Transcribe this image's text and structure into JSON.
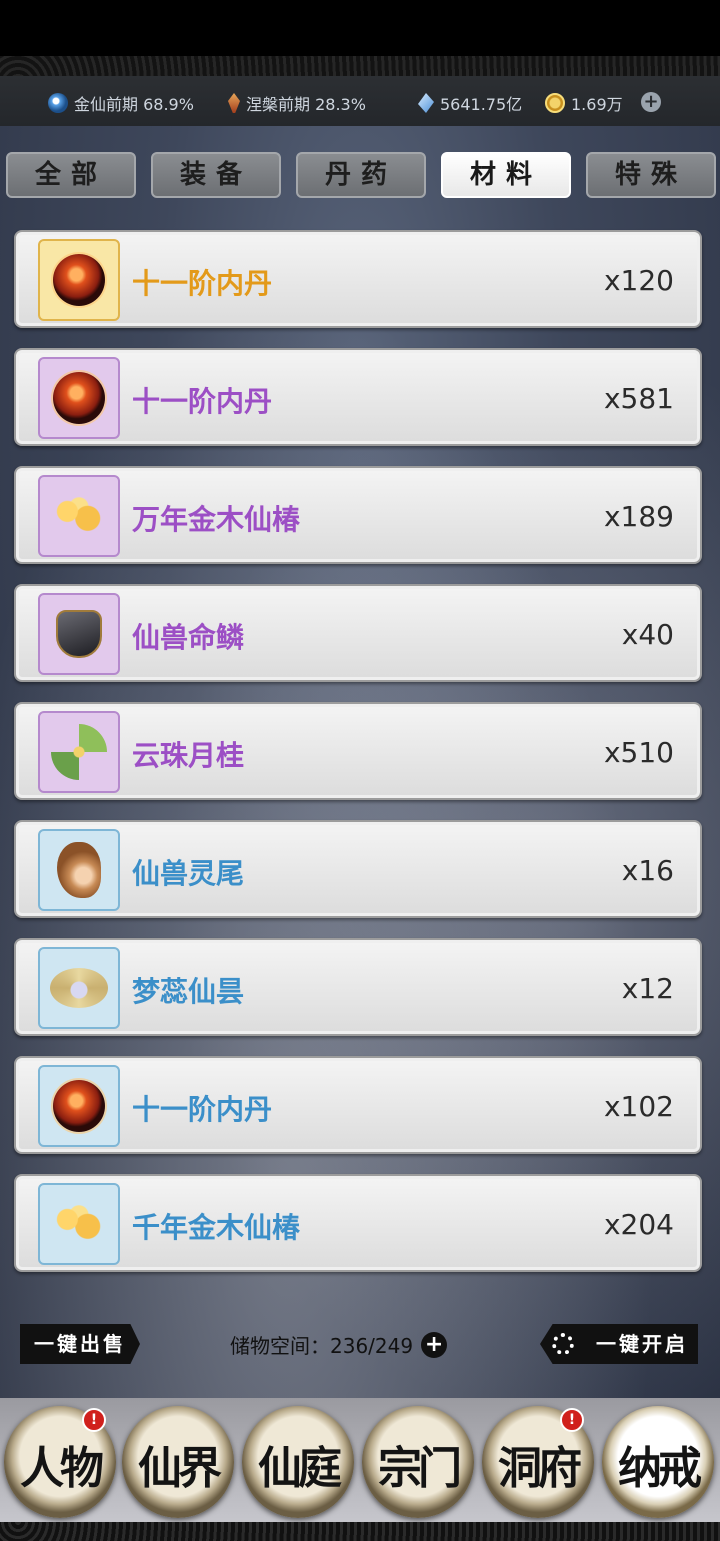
{
  "status": {
    "realm1": "金仙前期 68.9%",
    "realm2": "涅槃前期 28.3%",
    "crystals": "5641.75亿",
    "coins": "1.69万",
    "add_label": "+"
  },
  "tabs": [
    {
      "label": "全部",
      "active": false
    },
    {
      "label": "装备",
      "active": false
    },
    {
      "label": "丹药",
      "active": false
    },
    {
      "label": "材料",
      "active": true
    },
    {
      "label": "特殊",
      "active": false
    }
  ],
  "items": [
    {
      "name": "十一阶内丹",
      "count": "x120",
      "quality": "gold",
      "icon": "inner-core-icon"
    },
    {
      "name": "十一阶内丹",
      "count": "x581",
      "quality": "purple",
      "icon": "inner-core-icon"
    },
    {
      "name": "万年金木仙椿",
      "count": "x189",
      "quality": "purple",
      "icon": "golden-tree-icon"
    },
    {
      "name": "仙兽命鳞",
      "count": "x40",
      "quality": "purple",
      "icon": "beast-scale-icon"
    },
    {
      "name": "云珠月桂",
      "count": "x510",
      "quality": "purple",
      "icon": "osmanthus-icon"
    },
    {
      "name": "仙兽灵尾",
      "count": "x16",
      "quality": "blue",
      "icon": "beast-tail-icon"
    },
    {
      "name": "梦蕊仙昙",
      "count": "x12",
      "quality": "blue",
      "icon": "lotus-icon"
    },
    {
      "name": "十一阶内丹",
      "count": "x102",
      "quality": "blue",
      "icon": "inner-core-icon"
    },
    {
      "name": "千年金木仙椿",
      "count": "x204",
      "quality": "blue",
      "icon": "golden-tree-icon"
    }
  ],
  "bottom": {
    "sell_all": "一键出售",
    "storage": "储物空间：236/249",
    "add": "+",
    "open_all": "一键开启"
  },
  "nav": [
    {
      "label": "人物",
      "badge": "!"
    },
    {
      "label": "仙界",
      "badge": ""
    },
    {
      "label": "仙庭",
      "badge": ""
    },
    {
      "label": "宗门",
      "badge": ""
    },
    {
      "label": "洞府",
      "badge": "!"
    },
    {
      "label": "纳戒",
      "badge": ""
    }
  ]
}
